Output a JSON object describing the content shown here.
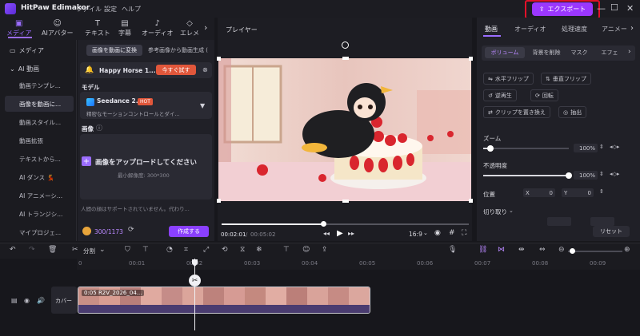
{
  "app": {
    "title": "HitPaw Edimakor",
    "menu": [
      "ファイル",
      "設定",
      "ヘルプ"
    ],
    "export_label": "エクスポート",
    "accent": "#9b37ff",
    "highlight": "#e2112a"
  },
  "tooltabs": [
    {
      "label": "メディア",
      "icon": "folder-icon"
    },
    {
      "label": "AIアバター",
      "icon": "avatar-icon"
    },
    {
      "label": "テキスト",
      "icon": "text-icon"
    },
    {
      "label": "字幕",
      "icon": "subtitle-icon"
    },
    {
      "label": "オーディオ",
      "icon": "music-icon"
    },
    {
      "label": "エレメ",
      "icon": "element-icon"
    }
  ],
  "sidebar": {
    "media": "メディア",
    "ai_video": "AI 動画",
    "items": [
      "動画テンプレ...",
      "画像を動画に...",
      "動画スタイル...",
      "動画拡張",
      "テキストから...",
      "AI ダンス 💃",
      "AI アニメーシ...",
      "AI トランジシ...",
      "マイプロジェ..."
    ]
  },
  "mediapanel": {
    "tabs": [
      "画像を動画に変換",
      "参考画像から動画生成 ("
    ],
    "banner_text": "Happy Horse 1....",
    "banner_button": "今すぐ試す",
    "model_label": "モデル",
    "model_name": "Seedance 2.0",
    "model_badge": "HOT",
    "model_desc": "精密なモーションコントロールとダイ...",
    "image_label": "画像",
    "upload_title": "画像をアップロードしてください",
    "upload_hint": "最小解像度: 300*300",
    "notice": "人間の顔はサポートされていません。代わり...",
    "credits": "300/1173",
    "create_button": "作成する"
  },
  "player": {
    "title": "プレイヤー",
    "time_current": "00:02:01",
    "time_total": "00:05:02",
    "ratio": "16:9",
    "progress": 0.41
  },
  "props": {
    "tabs": [
      "動画",
      "オーディオ",
      "処理速度",
      "アニメー"
    ],
    "chips": [
      "ボリューム",
      "背景を削除",
      "マスク",
      "エフェ"
    ],
    "buttons": [
      "水平フリップ",
      "垂直フリップ",
      "逆再生",
      "回転",
      "クリップを置き換え",
      "抽出"
    ],
    "zoom_label": "ズーム",
    "zoom_value": "100%",
    "opacity_label": "不透明度",
    "opacity_value": "100%",
    "position_label": "位置",
    "pos_x_label": "X",
    "pos_x": "0",
    "pos_y_label": "Y",
    "pos_y": "0",
    "crop_label": "切り取り",
    "reset": "リセット",
    "zoom_level": 0.08,
    "opacity_level": 1.0
  },
  "timeline": {
    "split_label": "分割",
    "ticks": [
      "0",
      "00:01",
      "00:02",
      "00:03",
      "00:04",
      "00:05",
      "00:06",
      "00:07",
      "00:08",
      "00:09"
    ],
    "cover_label": "カバー",
    "clip_label": "0:05  R2V_2026_04..."
  }
}
